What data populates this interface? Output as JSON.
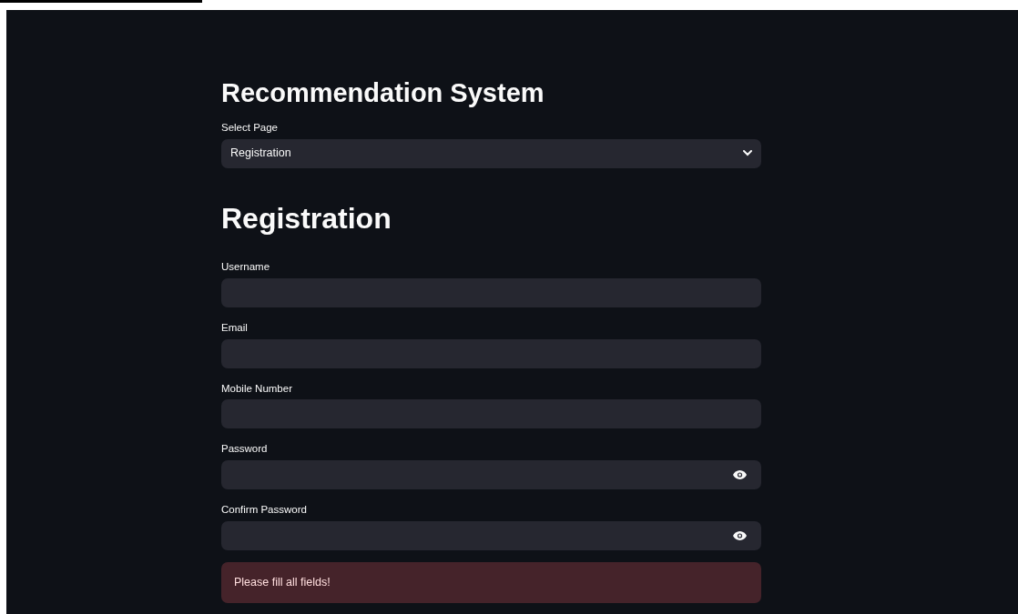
{
  "title": "Recommendation System",
  "page_select": {
    "label": "Select Page",
    "value": "Registration"
  },
  "heading": "Registration",
  "fields": [
    {
      "label": "Username",
      "kind": "text"
    },
    {
      "label": "Email",
      "kind": "text"
    },
    {
      "label": "Mobile Number",
      "kind": "text"
    },
    {
      "label": "Password",
      "kind": "password"
    },
    {
      "label": "Confirm Password",
      "kind": "password"
    }
  ],
  "alert": {
    "text": "Please fill all fields!",
    "kind": "error"
  }
}
